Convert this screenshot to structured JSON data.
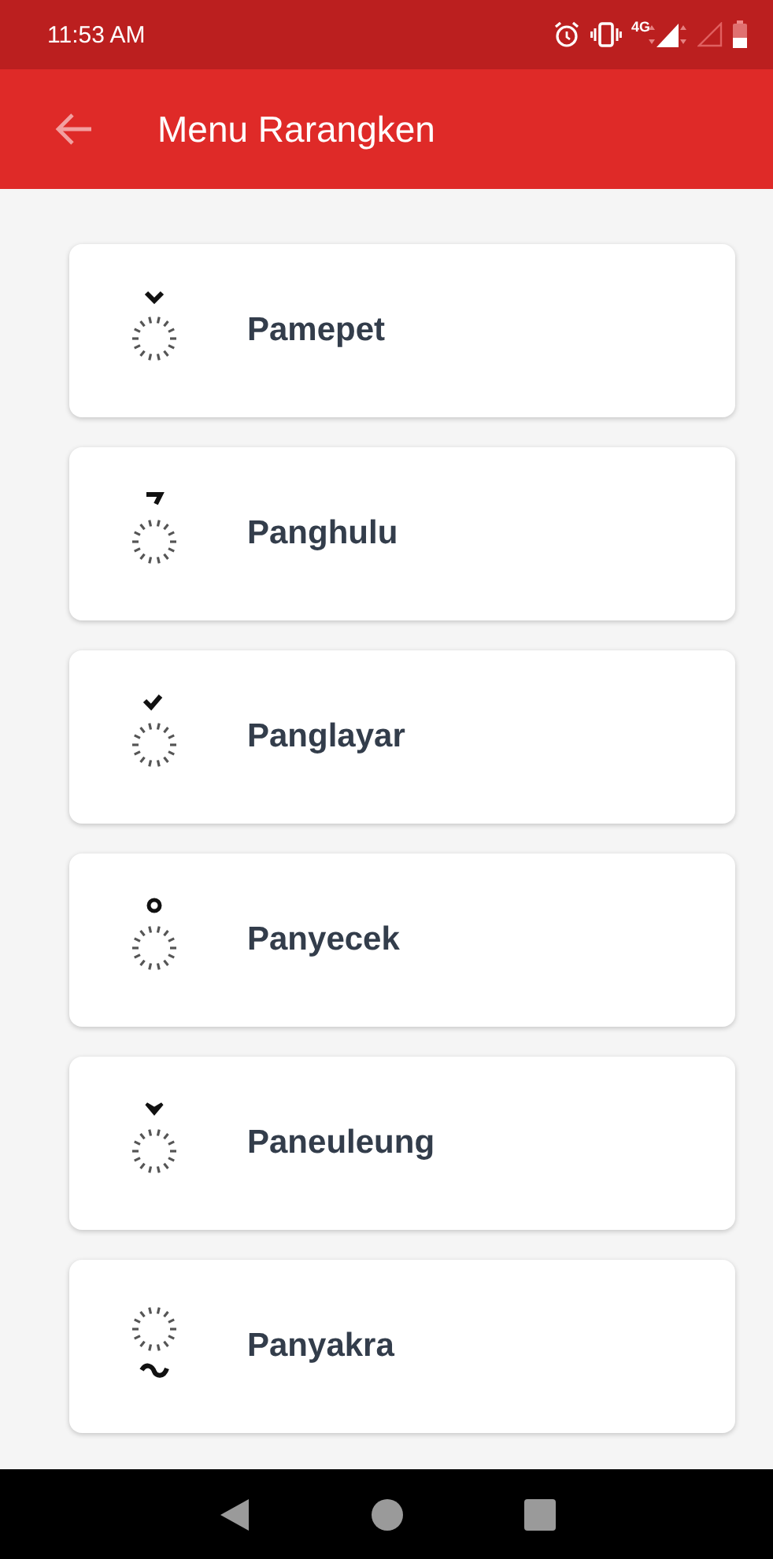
{
  "status_bar": {
    "time": "11:53 AM",
    "network": "4G"
  },
  "app_bar": {
    "title": "Menu Rarangken"
  },
  "items": [
    {
      "label": "Pamepet",
      "kind": "chevron-above"
    },
    {
      "label": "Panghulu",
      "kind": "hook-above"
    },
    {
      "label": "Panglayar",
      "kind": "zigzag-above"
    },
    {
      "label": "Panyecek",
      "kind": "ring-above"
    },
    {
      "label": "Paneuleung",
      "kind": "arrow-above"
    },
    {
      "label": "Panyakra",
      "kind": "tilde-below"
    }
  ]
}
